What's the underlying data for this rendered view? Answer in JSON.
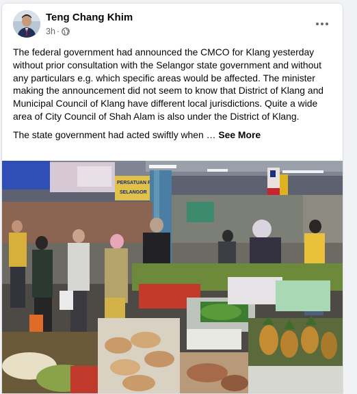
{
  "post": {
    "author": "Teng Chang Khim",
    "time": "3h",
    "separator": "·",
    "privacy_icon": "globe-icon",
    "more_icon": "more-horizontal-icon",
    "paragraph1": "The federal government had announced the CMCO for Klang yesterday without prior consultation with the  Selangor state government and without any particulars e.g. which specific areas would be affected. The minister making the announcement did not seem to know that District of Klang and Municipal Council of Klang have different local jurisdictions. Quite a wide area of City Council of Shah Alam is also under the District of Klang.",
    "paragraph2": "The state government had acted swiftly when …",
    "see_more": "See More",
    "photo": {
      "banner_left": "PERSATUAN PEN",
      "banner_left_sub": "SELANGOR"
    }
  },
  "colors": {
    "text": "#050505",
    "secondary_text": "#65676b",
    "card_bg": "#ffffff",
    "page_bg": "#f0f2f5"
  }
}
